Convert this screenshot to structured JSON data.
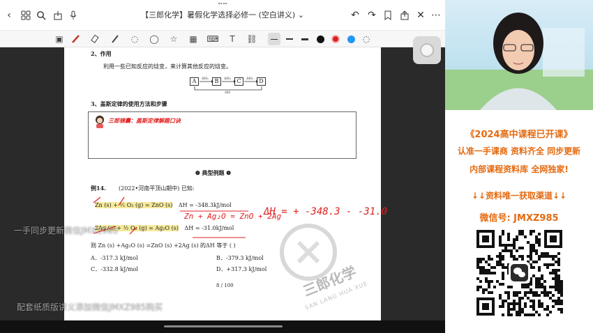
{
  "titlebar": {
    "title": "【三郎化学】暑假化学选择必修一 (空白讲义)",
    "title_caret": "⌄"
  },
  "toolbar": {
    "pen_colors": [
      "#111111",
      "#e02020",
      "#2196f3"
    ]
  },
  "paper": {
    "section2_heading": "2、作用",
    "section2_text": "利用一些已知反应的焓变，来计算其他反应的焓变。",
    "flow_boxes": [
      "A",
      "B",
      "C",
      "D"
    ],
    "flow_labels": [
      "ΔH₁",
      "ΔH₂",
      "ΔH₃",
      "ΔH"
    ],
    "section3_heading": "3、盖斯定律的使用方法和步骤",
    "tip_label": "三郎锦囊：盖斯定律解题口诀",
    "example_title": "典型例题",
    "example_no": "例14.",
    "example_source": "(2022•河南平顶山期中) 已知:",
    "eq1_left": "Zn (s) + ½ O₂ (g) = ZnO (s)",
    "eq1_dh": "ΔH = -348.3kJ/mol",
    "eq2_left": "2Ag (s) + ½ O₂ (g) = Ag₂O (s)",
    "eq2_dh": "ΔH = -31.0kJ/mol",
    "question": "则 Zn (s) +Ag₂O (s) =ZnO (s) +2Ag (s) 的ΔH 等于 (      )",
    "options": [
      "A．-317.3 kJ/mol",
      "B．-379.3 kJ/mol",
      "C．-332.8 kJ/mol",
      "D．+317.3 kJ/mol"
    ],
    "page_no": "8 / 100",
    "handwriting_1": "Zn + Ag₂O = ZnO + 2Ag",
    "handwriting_2": "ΔH = + -348.3 - -31.0"
  },
  "overlays": {
    "watermark_mid": "一手同步更新微信JMXZ985",
    "watermark_bottom": "配套纸质版讲义添加微信JMXZ985购买",
    "brand_cn": "三郎化学",
    "brand_en": "SAN LANG HUA XUE"
  },
  "promo": {
    "line1": "《2024高中课程已开课》",
    "line2": "认准一手课商 资料齐全 同步更新",
    "line3": "内部课程资料库 全网独家!",
    "line4": "↓↓资料唯一获取渠道↓↓",
    "line5": "微信号: JMXZ985",
    "accent": "#e46a10"
  }
}
